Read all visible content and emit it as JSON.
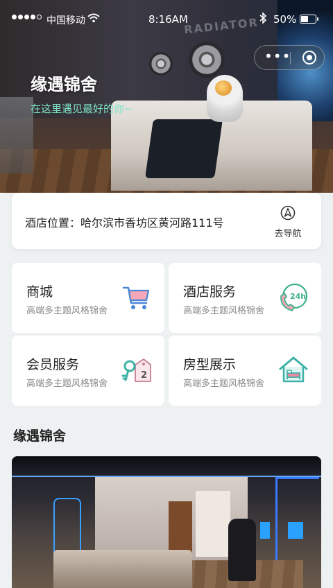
{
  "status_bar": {
    "carrier": "中国移动",
    "time": "8:16AM",
    "battery": "50%"
  },
  "hero": {
    "title": "缘遇锦舍",
    "subtitle": "在这里遇见最好的你~",
    "sign_text": "RADIATOR"
  },
  "capsule": {
    "more_label": "•••"
  },
  "location": {
    "label": "酒店位置：哈尔滨市香坊区黄河路111号",
    "nav_label": "去导航"
  },
  "tiles": [
    {
      "title": "商城",
      "desc": "高端多主题风格锦舍",
      "icon": "shopping-cart-icon"
    },
    {
      "title": "酒店服务",
      "desc": "高端多主题风格锦舍",
      "icon": "phone-24h-icon"
    },
    {
      "title": "会员服务",
      "desc": "高端多主题风格锦舍",
      "icon": "key-tag-icon"
    },
    {
      "title": "房型展示",
      "desc": "高端多主题风格锦舍",
      "icon": "house-bed-icon"
    }
  ],
  "section": {
    "title": "缘遇锦舍"
  },
  "colors": {
    "accent_teal": "#7ee3c6",
    "icon_blue": "#4a86d8",
    "icon_pink": "#f08aa0",
    "icon_green": "#3fb28a"
  }
}
